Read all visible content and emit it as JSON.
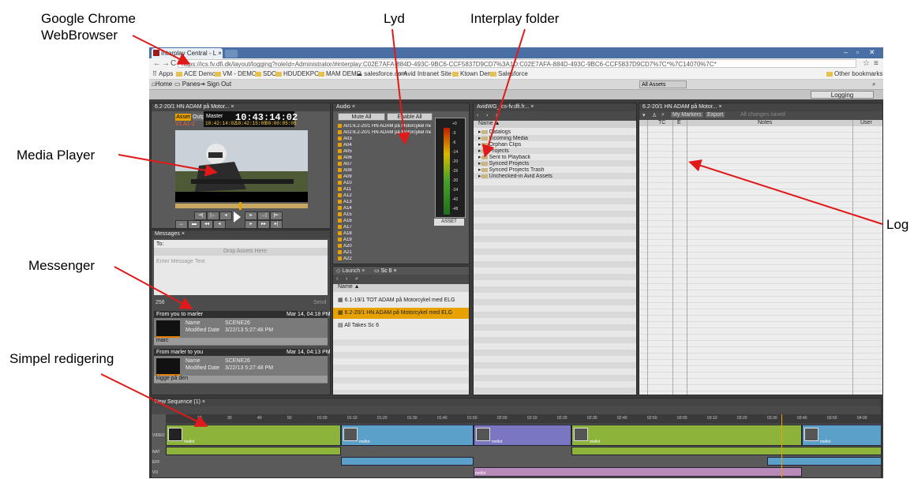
{
  "callouts": {
    "chrome": "Google Chrome\nWebBrowser",
    "lyd": "Lyd",
    "interplay_folder": "Interplay folder",
    "media_player": "Media Player",
    "log": "Log",
    "messenger": "Messenger",
    "simpel": "Simpel redigering"
  },
  "browser": {
    "tab_title": "Interplay Central - L",
    "url": "https://ics.fv.dfi.dk/layout/logging?roleId=Administrator/#interplay:C02E7AFA-884D-493C-9BC6-CCF5837D9CD7%3A1D:C02E7AFA-884D-493C-9BC6-CCF5837D9CD7%7C*%7C14070%7C*",
    "bookmarks": [
      "Apps",
      "ACE Demo",
      "VM - DEMO",
      "SDC",
      "HDUDEKPO",
      "MAM DEMO",
      "salesforce.com",
      "Avid Intranet Site",
      "Ktown Demo",
      "Salesforce"
    ],
    "other_bookmarks": "Other bookmarks"
  },
  "app": {
    "home": "Home",
    "panes": "Panes",
    "sign_out": "Sign Out",
    "asset_filter": "All Assets",
    "mode": "Logging"
  },
  "player": {
    "tab": "6.2-20/1 HN ADAM på Motor...",
    "asset_btn": "Asset",
    "output_btn": "Output",
    "track_lbl": "V1 A1-2",
    "master_lbl": "Master",
    "timecode": "10:43:14:02",
    "tc_in": "10:42:14:02",
    "tc_out": "10:42:15:05",
    "tc_dur": "00:00:05:05"
  },
  "messages": {
    "tab": "Messages",
    "to_label": "To:",
    "drop_hint": "Drop Assets Here",
    "enter_hint": "Enter Message Text",
    "char_count": "256",
    "send": "Send",
    "items": [
      {
        "header": "From you to marler",
        "date": "Mar 14, 04:18 PM",
        "name_lbl": "Name",
        "name_val": "SCENE26",
        "mod_lbl": "Modified Date",
        "mod_val": "3/22/13 5:27:48 PM",
        "body": "marc"
      },
      {
        "header": "From marler to you",
        "date": "Mar 14, 04:13 PM",
        "name_lbl": "Name",
        "name_val": "SCENE26",
        "mod_lbl": "Modified Date",
        "mod_val": "3/22/13 5:27:48 PM",
        "body": "kigge på den"
      }
    ]
  },
  "audio": {
    "tab": "Audio",
    "mute_all": "Mute All",
    "enable_all": "Enable All",
    "tracks": [
      "A01:6.2-20/1 HN ADAM på Motorcykel med E",
      "A02:6.2-20/1 HN ADAM på Motorcykel med E",
      "A03",
      "A04",
      "A05",
      "A06",
      "A07",
      "A08",
      "A09",
      "A10",
      "A11",
      "A12",
      "A13",
      "A14",
      "A15",
      "A16",
      "A17",
      "A18",
      "A19",
      "A20",
      "A21",
      "A22"
    ],
    "meter_scale": [
      "+0",
      "-3",
      "-6",
      "-14",
      "-20",
      "-26",
      "-30",
      "-34",
      "-42",
      "-48"
    ],
    "asset_btn": "ASSET"
  },
  "launch": {
    "tab_launch": "Launch",
    "tab_sc": "Sc 6",
    "name_col": "Name",
    "items": [
      "6.1-19/1 TOT ADAM på Motorcykel med ELG",
      "6.2-20/1 HN ADAM på Motorcykel med ELG",
      "All Takes Sc 6"
    ],
    "selected_index": 1
  },
  "folders": {
    "tab": "AvidWG_ics-fv.dfi.fr...",
    "name_col": "Name",
    "items": [
      "Catalogs",
      "Incoming Media",
      "Orphan Clips",
      "Projects",
      "Sent to Playback",
      "Synced Projects",
      "Synced Projects Trash",
      "Unchecked-in Avid Assets"
    ]
  },
  "log": {
    "tab": "6.2-20/1 HN ADAM på Motor...",
    "my_markers": "My Markers",
    "export": "Export",
    "search_hint": "All changes saved",
    "col_tc": "TC",
    "col_e": "E",
    "col_notes": "Notes",
    "col_user": "User"
  },
  "timeline": {
    "tab": "New Sequence (1)",
    "ruler": [
      "20",
      "30",
      "40",
      "50",
      "01:00",
      "01:10",
      "01:20",
      "01:30",
      "01:40",
      "01:50",
      "02:00",
      "02:10",
      "02:20",
      "02:30",
      "02:40",
      "02:50",
      "03:00",
      "03:10",
      "03:20",
      "03:30",
      "03:40",
      "03:50",
      "04:00"
    ],
    "track_labels": [
      "VIDEO",
      "NAT",
      "EFF",
      "VO"
    ],
    "clip_name": "mellot",
    "vo_clip": "mellot",
    "colors": {
      "video_a": "#8db33a",
      "video_b": "#5aa0c8",
      "video_c": "#7b76c2",
      "vo": "#b98ab8"
    }
  }
}
